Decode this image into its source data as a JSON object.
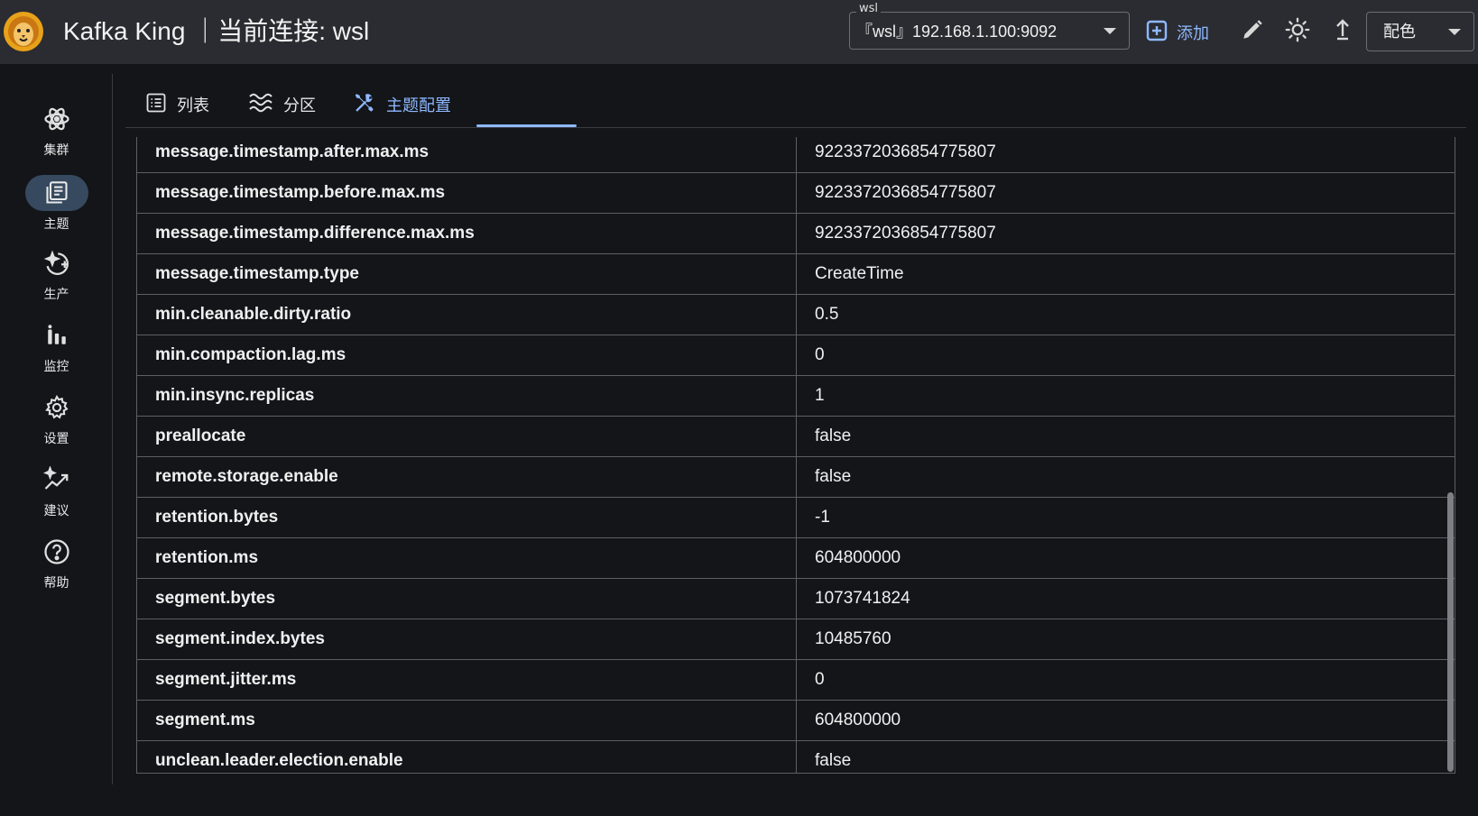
{
  "header": {
    "app_title": "Kafka King ｜当前连接: wsl",
    "connection_label": "wsl",
    "connection_value": "『wsl』192.168.1.100:9092",
    "add_label": "添加",
    "palette_label": "配色"
  },
  "sidebar": {
    "items": [
      {
        "label": "集群",
        "icon": "atom-icon"
      },
      {
        "label": "主题",
        "icon": "library-icon"
      },
      {
        "label": "生产",
        "icon": "sparkle-add-icon"
      },
      {
        "label": "监控",
        "icon": "bars-icon"
      },
      {
        "label": "设置",
        "icon": "gear-icon"
      },
      {
        "label": "建议",
        "icon": "sparkle-trend-icon"
      },
      {
        "label": "帮助",
        "icon": "help-icon"
      }
    ],
    "active_index": 1
  },
  "tabs": [
    {
      "label": "列表",
      "icon": "list-icon"
    },
    {
      "label": "分区",
      "icon": "waves-icon"
    },
    {
      "label": "主题配置",
      "icon": "tools-icon"
    }
  ],
  "active_tab": 2,
  "colors": {
    "accent": "#8fb8ff",
    "header_bg": "#2a2c31",
    "page_bg": "#131519",
    "active_pill": "#36495f"
  },
  "config_rows": [
    {
      "key": "message.timestamp.after.max.ms",
      "value": "9223372036854775807"
    },
    {
      "key": "message.timestamp.before.max.ms",
      "value": "9223372036854775807"
    },
    {
      "key": "message.timestamp.difference.max.ms",
      "value": "9223372036854775807"
    },
    {
      "key": "message.timestamp.type",
      "value": "CreateTime"
    },
    {
      "key": "min.cleanable.dirty.ratio",
      "value": "0.5"
    },
    {
      "key": "min.compaction.lag.ms",
      "value": "0"
    },
    {
      "key": "min.insync.replicas",
      "value": "1"
    },
    {
      "key": "preallocate",
      "value": "false"
    },
    {
      "key": "remote.storage.enable",
      "value": "false"
    },
    {
      "key": "retention.bytes",
      "value": "-1"
    },
    {
      "key": "retention.ms",
      "value": "604800000"
    },
    {
      "key": "segment.bytes",
      "value": "1073741824"
    },
    {
      "key": "segment.index.bytes",
      "value": "10485760"
    },
    {
      "key": "segment.jitter.ms",
      "value": "0"
    },
    {
      "key": "segment.ms",
      "value": "604800000"
    },
    {
      "key": "unclean.leader.election.enable",
      "value": "false"
    }
  ]
}
